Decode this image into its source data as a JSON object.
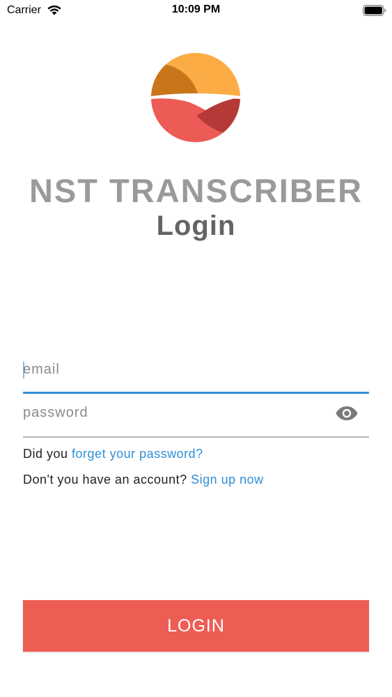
{
  "status_bar": {
    "carrier": "Carrier",
    "time": "10:09 PM"
  },
  "app": {
    "title": "NST TRANSCRIBER",
    "page_title": "Login"
  },
  "form": {
    "email": {
      "value": "",
      "placeholder": "email"
    },
    "password": {
      "value": "",
      "placeholder": "password",
      "toggle_icon": "eye-icon"
    },
    "forgot": {
      "prefix": "Did you ",
      "link": "forget your password?"
    },
    "signup": {
      "prefix": "Don't you have an account? ",
      "link": "Sign up now"
    },
    "login_label": "LOGIN"
  },
  "colors": {
    "accent_blue": "#2f8fd8",
    "login_button": "#ee5d54",
    "title_gray": "#9a9a9a",
    "subtitle_gray": "#646464",
    "logo_orange": "#fbac44",
    "logo_dark_orange": "#c9761b",
    "logo_red": "#ec5b55",
    "logo_dark_red": "#b53a37"
  },
  "icons": {
    "wifi": "wifi-icon",
    "battery": "battery-icon",
    "logo": "app-logo"
  }
}
